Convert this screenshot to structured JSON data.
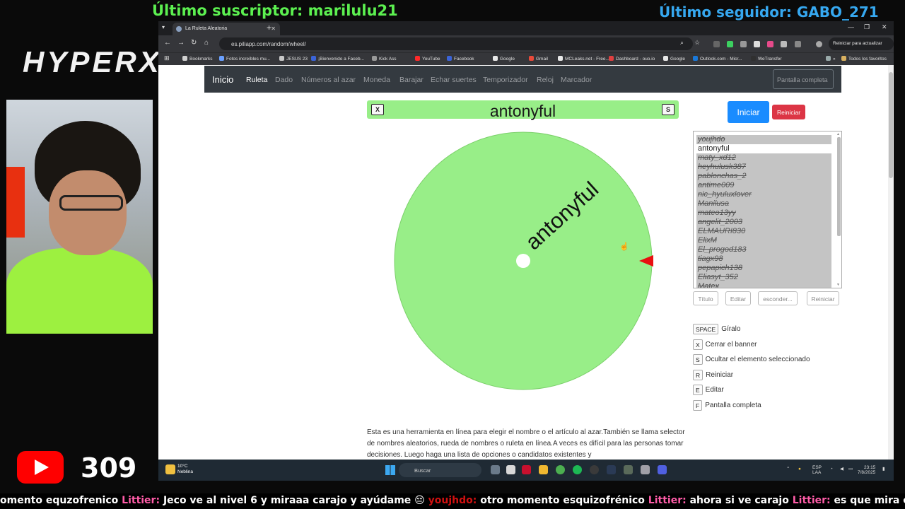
{
  "overlay": {
    "last_sub_label": "Último suscriptor: marilulu21",
    "last_follower_label": "Último seguidor: GABO_271",
    "brand_logo": "HYPERX",
    "youtube_count": "309",
    "ticker": [
      {
        "type": "text",
        "text": "omento equzofrenico "
      },
      {
        "type": "name",
        "text": "Littier: "
      },
      {
        "type": "text",
        "text": "Jeco ve al nivel 6 y miraaa carajo y ayúdame 😔 "
      },
      {
        "type": "red",
        "text": "youjhdo: "
      },
      {
        "type": "text",
        "text": "otro momento esquizofrénico "
      },
      {
        "type": "name",
        "text": "Littier: "
      },
      {
        "type": "text",
        "text": "ahora si ve carajo "
      },
      {
        "type": "name",
        "text": "Littier: "
      },
      {
        "type": "text",
        "text": "es que mira como estoy carajooo"
      }
    ]
  },
  "browser": {
    "tab_title": "La Ruleta Aleatoria",
    "url": "es.piliapp.com/random/wheel/",
    "update_button": "Reiniciar para actualizar",
    "bookmarks": [
      {
        "label": "Bookmarks",
        "color": "#d0d0d0"
      },
      {
        "label": "Fotos increíbles mu...",
        "color": "#6aa0ff"
      },
      {
        "label": "JESUS 23",
        "color": "#c8c8c8"
      },
      {
        "label": "¡Bienvenido a Faceb...",
        "color": "#3b64d8"
      },
      {
        "label": "Kick Ass",
        "color": "#9a9a9a"
      },
      {
        "label": "YouTube",
        "color": "#ff2a2a"
      },
      {
        "label": "Facebook",
        "color": "#3b64d8"
      },
      {
        "label": "Google",
        "color": "#e8e8e8"
      },
      {
        "label": "Gmail",
        "color": "#e84a3a"
      },
      {
        "label": "MCLeaks.net - Free...",
        "color": "#e8e8e8"
      },
      {
        "label": "Dashboard - ouo.io",
        "color": "#e04040"
      },
      {
        "label": "Google",
        "color": "#e8e8e8"
      },
      {
        "label": "Outlook.com - Micr...",
        "color": "#1a78d8"
      },
      {
        "label": "WeTransfer",
        "color": "#303030"
      }
    ],
    "all_favorites": "Todos los favoritos"
  },
  "navbar": {
    "brand": "Inicio",
    "links": [
      "Ruleta",
      "Dado",
      "Números al azar",
      "Moneda",
      "Barajar",
      "Echar suertes",
      "Temporizador",
      "Reloj",
      "Marcador"
    ],
    "active_link": "Ruleta",
    "fullscreen_button": "Pantalla completa"
  },
  "banner": {
    "close_key": "X",
    "hide_key": "S",
    "selected_name": "antonyful"
  },
  "wheel": {
    "fill_color": "#98ee88",
    "pointer_color": "#e81010",
    "label": "antonyful"
  },
  "controls": {
    "start_button": "Iniciar",
    "reset_button": "Reiniciar"
  },
  "entries": [
    {
      "name": "youjhdo",
      "hidden": true
    },
    {
      "name": "antonyful",
      "hidden": false
    },
    {
      "name": "maty_xd12",
      "hidden": true
    },
    {
      "name": "heyhulusk387",
      "hidden": true
    },
    {
      "name": "pablonchas_2",
      "hidden": true
    },
    {
      "name": "antime009",
      "hidden": true
    },
    {
      "name": "nic_hyuluxlover",
      "hidden": true
    },
    {
      "name": "Manilusa",
      "hidden": true
    },
    {
      "name": "mateo13yy",
      "hidden": true
    },
    {
      "name": "angelit_2003",
      "hidden": true
    },
    {
      "name": "ELMAURI830",
      "hidden": true
    },
    {
      "name": "ElixM",
      "hidden": true
    },
    {
      "name": "El_progod183",
      "hidden": true
    },
    {
      "name": "tiagx98",
      "hidden": true
    },
    {
      "name": "pepapich138",
      "hidden": true
    },
    {
      "name": "Eliasyt_352",
      "hidden": true
    },
    {
      "name": "Matex",
      "hidden": true
    }
  ],
  "list_buttons": [
    "Título",
    "Editar",
    "esconder...",
    "Reiniciar"
  ],
  "shortcuts": [
    {
      "key": "SPACE",
      "label": "Gíralo"
    },
    {
      "key": "X",
      "label": "Cerrar el banner"
    },
    {
      "key": "S",
      "label": "Ocultar el elemento seleccionado"
    },
    {
      "key": "R",
      "label": "Reiniciar"
    },
    {
      "key": "E",
      "label": "Editar"
    },
    {
      "key": "F",
      "label": "Pantalla completa"
    }
  ],
  "description": "Esta es una herramienta en línea para elegir el nombre o el artículo al azar.También se llama selector de nombres aleatorios, rueda de nombres o ruleta en línea.A veces es difícil para las personas tomar decisiones. Luego haga una lista de opciones o candidatos existentes y",
  "taskbar": {
    "weather_temp": "10°C",
    "weather_desc": "Neblina",
    "search_placeholder": "Buscar",
    "lang_top": "ESP",
    "lang_bottom": "LAA",
    "time": "23:15",
    "date": "7/8/2025"
  }
}
